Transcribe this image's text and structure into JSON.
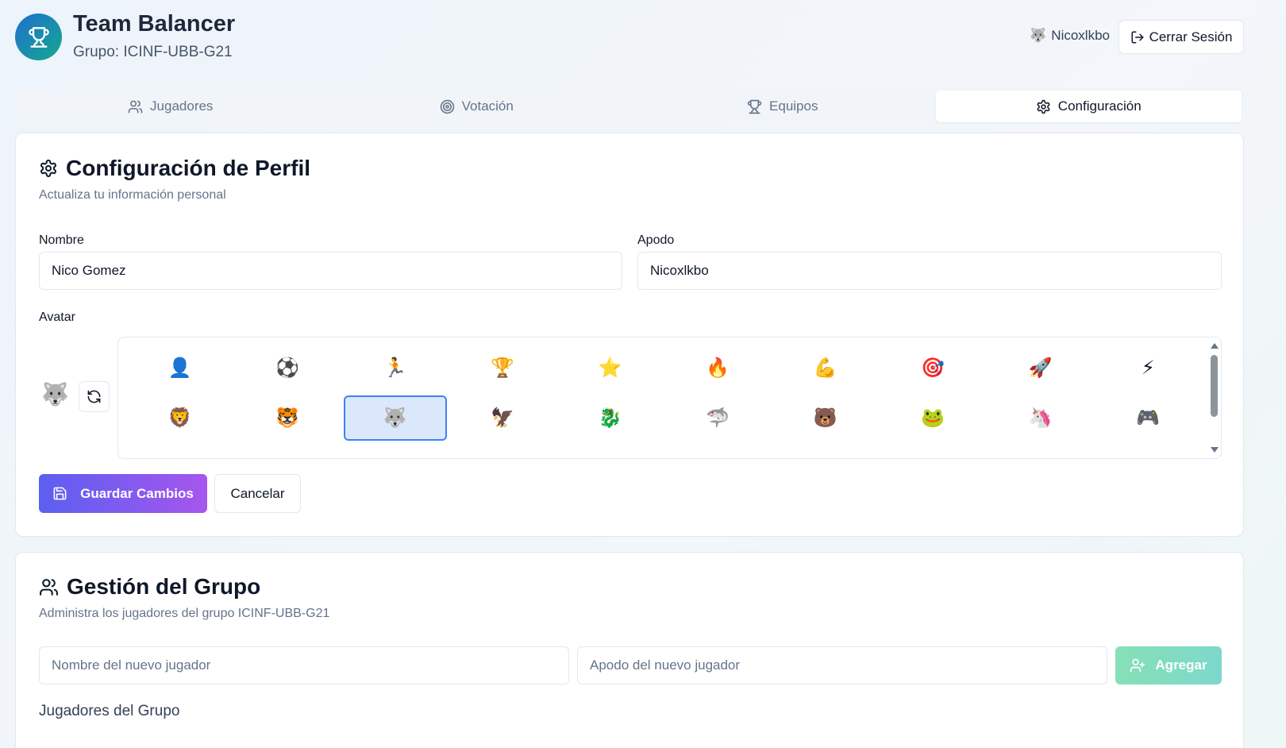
{
  "header": {
    "title": "Team Balancer",
    "subtitle": "Grupo: ICINF-UBB-G21",
    "user_avatar": "🐺",
    "user_name": "Nicoxlkbo",
    "logout_label": "Cerrar Sesión"
  },
  "tabs": [
    {
      "label": "Jugadores",
      "icon": "users-icon",
      "active": false
    },
    {
      "label": "Votación",
      "icon": "target-icon",
      "active": false
    },
    {
      "label": "Equipos",
      "icon": "trophy-icon",
      "active": false
    },
    {
      "label": "Configuración",
      "icon": "gear-icon",
      "active": true
    }
  ],
  "profile": {
    "title": "Configuración de Perfil",
    "description": "Actualiza tu información personal",
    "name_label": "Nombre",
    "name_value": "Nico Gomez",
    "nickname_label": "Apodo",
    "nickname_value": "Nicoxlkbo",
    "avatar_label": "Avatar",
    "current_avatar": "🐺",
    "avatars": [
      "👤",
      "⚽",
      "🏃",
      "🏆",
      "⭐",
      "🔥",
      "💪",
      "🎯",
      "🚀",
      "⚡",
      "🦁",
      "🐯",
      "🐺",
      "🦅",
      "🐉",
      "🦈",
      "🐻",
      "🐸",
      "🦄",
      "🎮"
    ],
    "selected_avatar_index": 12,
    "save_label": "Guardar Cambios",
    "cancel_label": "Cancelar"
  },
  "group": {
    "title": "Gestión del Grupo",
    "description": "Administra los jugadores del grupo ICINF-UBB-G21",
    "new_name_placeholder": "Nombre del nuevo jugador",
    "new_nickname_placeholder": "Apodo del nuevo jugador",
    "add_label": "Agregar",
    "players_heading": "Jugadores del Grupo"
  },
  "colors": {
    "accent_start": "#5b5ff0",
    "accent_end": "#a656ee",
    "add_button": "#86e0b6",
    "selected_border": "#3b82f6",
    "logo_start": "#1f6fd1",
    "logo_end": "#13a98c"
  }
}
